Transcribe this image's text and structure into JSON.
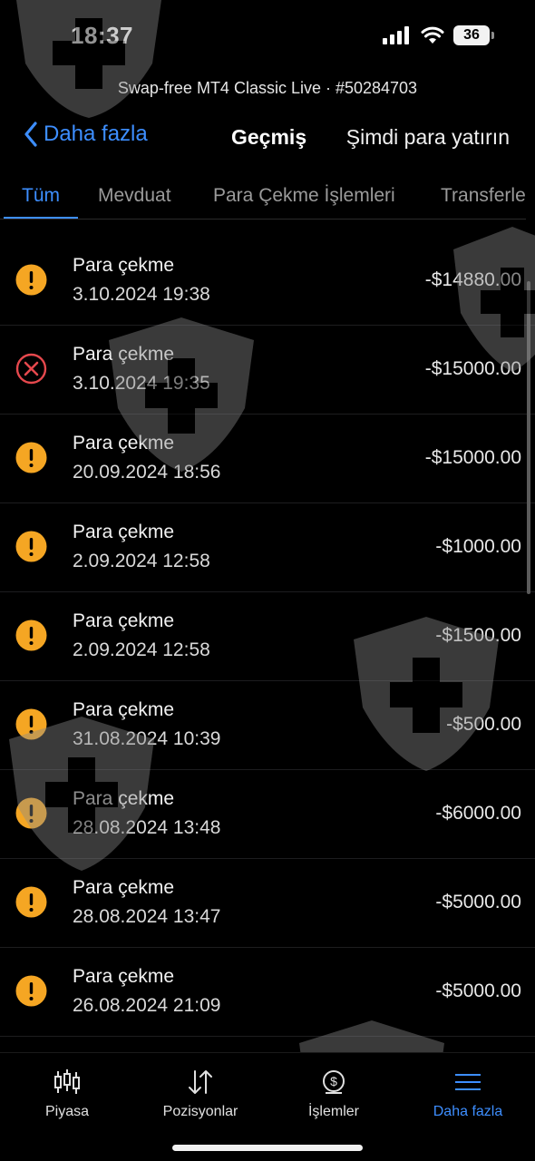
{
  "status_bar": {
    "time": "18:37",
    "battery": "36"
  },
  "account_line": "Swap-free MT4 Classic Live · #50284703",
  "nav": {
    "back_label": "Daha fazla",
    "title": "Geçmiş",
    "action_label": "Şimdi para yatırın"
  },
  "tabs": [
    {
      "label": "Tüm",
      "active": true
    },
    {
      "label": "Mevduat",
      "active": false
    },
    {
      "label": "Para Çekme İşlemleri",
      "active": false
    },
    {
      "label": "Transferler",
      "active": false
    }
  ],
  "transactions": [
    {
      "type": "Para çekme",
      "date": "3.10.2024 19:38",
      "amount": "-$14880.00",
      "status_icon": "pending-icon"
    },
    {
      "type": "Para çekme",
      "date": "3.10.2024 19:35",
      "amount": "-$15000.00",
      "status_icon": "failed-icon"
    },
    {
      "type": "Para çekme",
      "date": "20.09.2024 18:56",
      "amount": "-$15000.00",
      "status_icon": "pending-icon"
    },
    {
      "type": "Para çekme",
      "date": "2.09.2024 12:58",
      "amount": "-$1000.00",
      "status_icon": "pending-icon"
    },
    {
      "type": "Para çekme",
      "date": "2.09.2024 12:58",
      "amount": "-$1500.00",
      "status_icon": "pending-icon"
    },
    {
      "type": "Para çekme",
      "date": "31.08.2024 10:39",
      "amount": "-$500.00",
      "status_icon": "pending-icon"
    },
    {
      "type": "Para çekme",
      "date": "28.08.2024 13:48",
      "amount": "-$6000.00",
      "status_icon": "pending-icon"
    },
    {
      "type": "Para çekme",
      "date": "28.08.2024 13:47",
      "amount": "-$5000.00",
      "status_icon": "pending-icon"
    },
    {
      "type": "Para çekme",
      "date": "26.08.2024 21:09",
      "amount": "-$5000.00",
      "status_icon": "pending-icon"
    }
  ],
  "tabbar": [
    {
      "label": "Piyasa",
      "icon": "candlestick-icon",
      "active": false
    },
    {
      "label": "Pozisyonlar",
      "icon": "sort-arrows-icon",
      "active": false
    },
    {
      "label": "İşlemler",
      "icon": "dollar-coin-icon",
      "active": false
    },
    {
      "label": "Daha fazla",
      "icon": "menu-icon",
      "active": true
    }
  ],
  "colors": {
    "accent": "#3d8eff",
    "pending": "#f5a623",
    "failed": "#e5484d",
    "background": "#000000"
  }
}
